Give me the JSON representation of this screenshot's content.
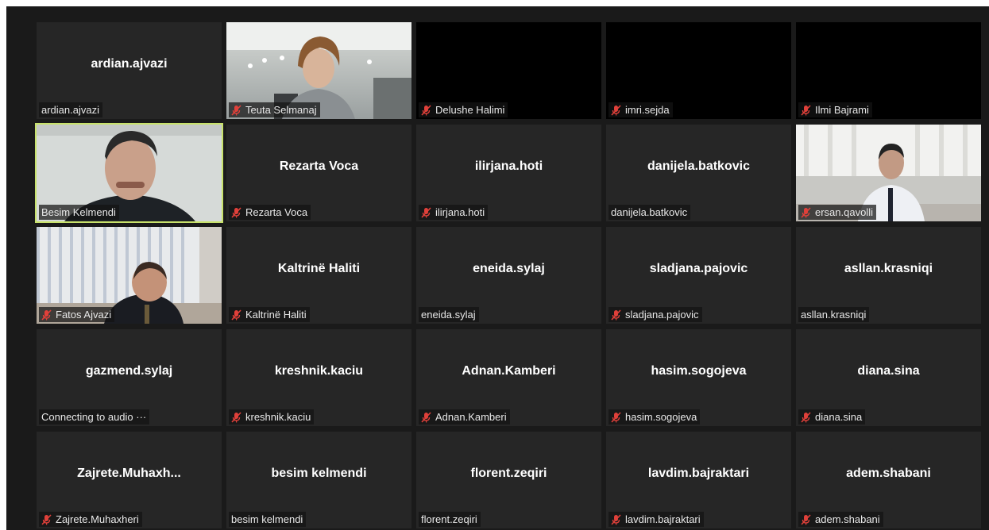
{
  "participants": [
    {
      "display": "ardian.ajvazi",
      "label": "ardian.ajvazi",
      "muted": false,
      "video": "none"
    },
    {
      "display": "",
      "label": "Teuta Selmanaj",
      "muted": true,
      "video": "woman-office"
    },
    {
      "display": "",
      "label": "Delushe Halimi",
      "muted": true,
      "video": "black"
    },
    {
      "display": "",
      "label": "imri.sejda",
      "muted": true,
      "video": "black"
    },
    {
      "display": "",
      "label": "Ilmi Bajrami",
      "muted": true,
      "video": "black"
    },
    {
      "display": "",
      "label": "Besim Kelmendi",
      "muted": false,
      "video": "man-closeup",
      "speaking": true
    },
    {
      "display": "Rezarta Voca",
      "label": "Rezarta Voca",
      "muted": true,
      "video": "none"
    },
    {
      "display": "ilirjana.hoti",
      "label": "ilirjana.hoti",
      "muted": true,
      "video": "none"
    },
    {
      "display": "danijela.batkovic",
      "label": "danijela.batkovic",
      "muted": false,
      "video": "none"
    },
    {
      "display": "",
      "label": "ersan.qavolli",
      "muted": true,
      "video": "man-desk"
    },
    {
      "display": "",
      "label": "Fatos Ajvazi",
      "muted": true,
      "video": "man-blinds"
    },
    {
      "display": "Kaltrinë Haliti",
      "label": "Kaltrinë Haliti",
      "muted": true,
      "video": "none"
    },
    {
      "display": "eneida.sylaj",
      "label": "eneida.sylaj",
      "muted": false,
      "video": "none"
    },
    {
      "display": "sladjana.pajovic",
      "label": "sladjana.pajovic",
      "muted": true,
      "video": "none"
    },
    {
      "display": "asllan.krasniqi",
      "label": "asllan.krasniqi",
      "muted": false,
      "video": "none"
    },
    {
      "display": "gazmend.sylaj",
      "label": "Connecting to audio ···",
      "muted": false,
      "video": "none"
    },
    {
      "display": "kreshnik.kaciu",
      "label": "kreshnik.kaciu",
      "muted": true,
      "video": "none"
    },
    {
      "display": "Adnan.Kamberi",
      "label": "Adnan.Kamberi",
      "muted": true,
      "video": "none"
    },
    {
      "display": "hasim.sogojeva",
      "label": "hasim.sogojeva",
      "muted": true,
      "video": "none"
    },
    {
      "display": "diana.sina",
      "label": "diana.sina",
      "muted": true,
      "video": "none"
    },
    {
      "display": "Zajrete.Muhaxh...",
      "label": "Zajrete.Muhaxheri",
      "muted": true,
      "video": "none"
    },
    {
      "display": "besim kelmendi",
      "label": "besim kelmendi",
      "muted": false,
      "video": "none"
    },
    {
      "display": "florent.zeqiri",
      "label": "florent.zeqiri",
      "muted": false,
      "video": "none"
    },
    {
      "display": "lavdim.bajraktari",
      "label": "lavdim.bajraktari",
      "muted": true,
      "video": "none"
    },
    {
      "display": "adem.shabani",
      "label": "adem.shabani",
      "muted": true,
      "video": "none"
    }
  ],
  "colors": {
    "background": "#1a1a1a",
    "tile": "#262626",
    "speaking_border": "#c8e26b",
    "muted_icon": "#e0403a"
  },
  "icons": {
    "muted": "muted-mic-icon"
  }
}
